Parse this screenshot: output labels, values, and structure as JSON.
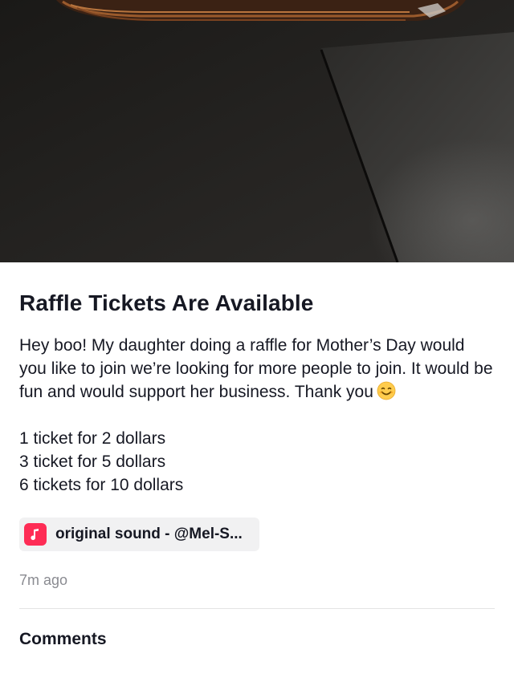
{
  "post": {
    "title": "Raffle Tickets Are Available",
    "body": {
      "intro": "Hey boo! My daughter doing a raffle for Mother’s Day would you like to join we’re looking for more people to join. It would be fun and would support her business. Thank you",
      "emoji_icon": "smiling-face-icon",
      "lines": [
        "1 ticket for 2 dollars",
        "3 ticket for 5 dollars",
        "6 tickets for 10 dollars"
      ]
    },
    "sound": {
      "label": "original sound - @Mel-S...",
      "icon": "music-note-icon",
      "icon_color": "#fe2c55"
    },
    "timestamp": "7m ago"
  },
  "comments": {
    "heading": "Comments"
  }
}
